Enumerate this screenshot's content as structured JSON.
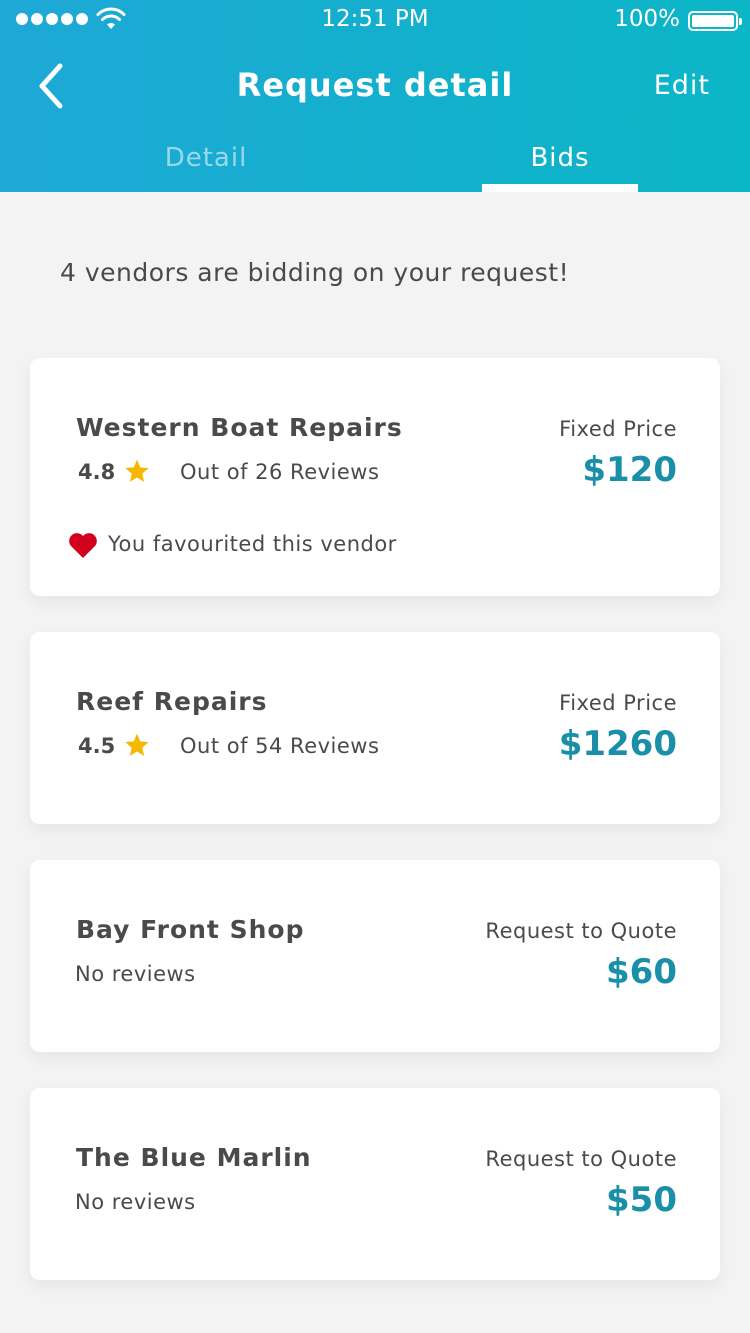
{
  "status_bar": {
    "time": "12:51 PM",
    "battery": "100%"
  },
  "header": {
    "title": "Request detail",
    "edit_label": "Edit"
  },
  "tabs": [
    {
      "label": "Detail",
      "active": false
    },
    {
      "label": "Bids",
      "active": true
    }
  ],
  "intro_text": "4 vendors are bidding on your request!",
  "colors": {
    "header_start": "#1ea8d6",
    "header_end": "#0bb6c6",
    "price": "#1a8fa8",
    "star": "#f5b800",
    "heart": "#d0021b"
  },
  "bids": [
    {
      "vendor": "Western Boat Repairs",
      "rating": "4.8",
      "reviews": "Out of 26 Reviews",
      "price_type": "Fixed Price",
      "price": "$120",
      "favourite_text": "You favourited this vendor"
    },
    {
      "vendor": "Reef Repairs",
      "rating": "4.5",
      "reviews": "Out of 54 Reviews",
      "price_type": "Fixed Price",
      "price": "$1260"
    },
    {
      "vendor": "Bay Front Shop",
      "reviews": "No reviews",
      "price_type": "Request to Quote",
      "price": "$60"
    },
    {
      "vendor": "The Blue Marlin",
      "reviews": "No reviews",
      "price_type": "Request to Quote",
      "price": "$50"
    }
  ]
}
